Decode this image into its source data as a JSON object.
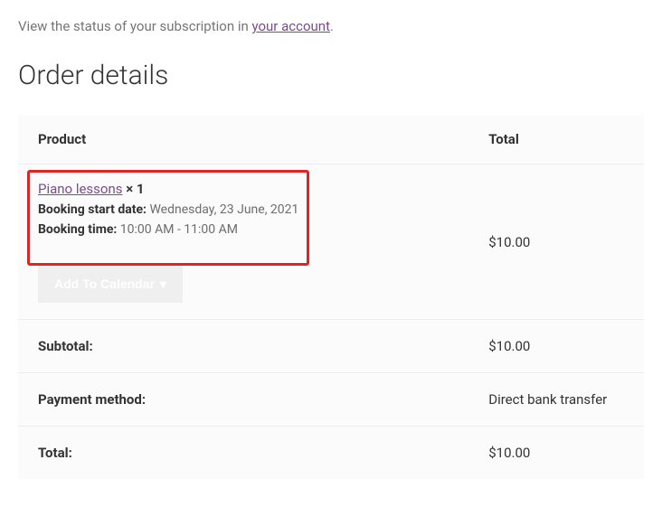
{
  "intro": {
    "prefix": "View the status of your subscription in ",
    "link_text": "your account",
    "suffix": "."
  },
  "heading": "Order details",
  "table": {
    "header": {
      "product": "Product",
      "total": "Total"
    },
    "item": {
      "product_name": "Piano lessons",
      "qty_separator": " × ",
      "qty": "1",
      "booking_date_label": "Booking start date:",
      "booking_date_value": " Wednesday, 23 June, 2021",
      "booking_time_label": "Booking time:",
      "booking_time_value": " 10:00 AM - 11:00 AM",
      "total": "$10.00",
      "add_calendar_label": "Add To Calendar",
      "caret": "▾"
    },
    "footer": {
      "subtotal_label": "Subtotal:",
      "subtotal_value": "$10.00",
      "payment_label": "Payment method:",
      "payment_value": "Direct bank transfer",
      "total_label": "Total:",
      "total_value": "$10.00"
    }
  }
}
